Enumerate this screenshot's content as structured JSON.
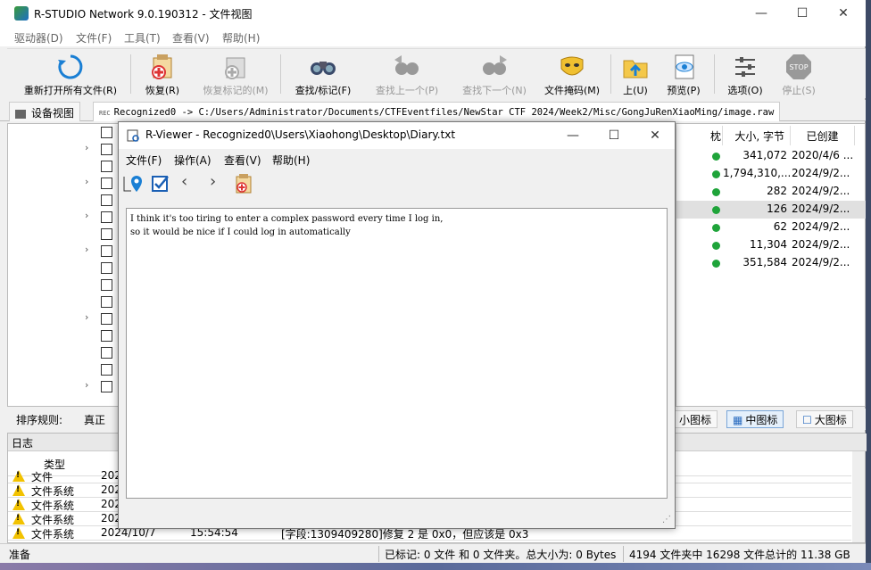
{
  "window": {
    "title": "R-STUDIO Network 9.0.190312 - 文件视图",
    "minimize": "—",
    "maximize": "☐",
    "close": "✕"
  },
  "menu": [
    "驱动器(D)",
    "文件(F)",
    "工具(T)",
    "查看(V)",
    "帮助(H)"
  ],
  "toolbar": {
    "reopen": "重新打开所有文件(R)",
    "recover": "恢复(R)",
    "recover_marked": "恢复标记的(M)",
    "find_mark": "查找/标记(F)",
    "find_prev": "查找上一个(P)",
    "find_next": "查找下一个(N)",
    "file_mask": "文件掩码(M)",
    "up": "上(U)",
    "preview": "预览(P)",
    "options": "选项(O)",
    "stop": "停止(S)",
    "stop_icon_text": "STOP"
  },
  "tabs": {
    "devices": "设备视图",
    "file_icon_text": "REC",
    "file": "Recognized0 -> C:/Users/Administrator/Documents/CTFEventfiles/NewStar CTF 2024/Week2/Misc/GongJuRenXiaoMing/image.raw"
  },
  "list": {
    "headers": [
      "枕",
      "大小, 字节",
      "已创建"
    ],
    "rows": [
      {
        "size": "341,072",
        "date": "2020/4/6 ..."
      },
      {
        "size": "1,794,310,...",
        "date": "2024/9/2..."
      },
      {
        "size": "282",
        "date": "2024/9/2..."
      },
      {
        "size": "126",
        "date": "2024/9/2..."
      },
      {
        "size": "62",
        "date": "2024/9/2..."
      },
      {
        "size": "11,304",
        "date": "2024/9/2..."
      },
      {
        "size": "351,584",
        "date": "2024/9/2..."
      }
    ]
  },
  "sortbar": {
    "label": "排序规则:",
    "value": "真正",
    "small_icons": "小图标",
    "medium_icons": "中图标",
    "large_icons": "大图标"
  },
  "log": {
    "title": "日志",
    "col_type": "类型",
    "rows": [
      {
        "type": "文件",
        "date": "202",
        "time": "",
        "msg": ""
      },
      {
        "type": "文件系统",
        "date": "202",
        "time": "",
        "msg": ""
      },
      {
        "type": "文件系统",
        "date": "202",
        "time": "",
        "msg": ""
      },
      {
        "type": "文件系统",
        "date": "202",
        "time": "",
        "msg": ""
      },
      {
        "type": "文件系统",
        "date": "2024/10/7",
        "time": "15:54:54",
        "msg": "[字段:1309409280]修复 2 是 0x0，但应该是 0x3"
      }
    ]
  },
  "status": {
    "ready": "准备",
    "marked": "已标记: 0 文件 和 0 文件夹。总大小为: 0 Bytes",
    "totals": "4194 文件夹中 16298 文件总计的 11.38 GB"
  },
  "viewer": {
    "title": "R-Viewer - Recognized0\\Users\\Xiaohong\\Desktop\\Diary.txt",
    "menu": [
      "文件(F)",
      "操作(A)",
      "查看(V)",
      "帮助(H)"
    ],
    "content": "I think it's too tiring to enter a complex password every time I log in,\nso it would be nice if I could log in automatically"
  }
}
